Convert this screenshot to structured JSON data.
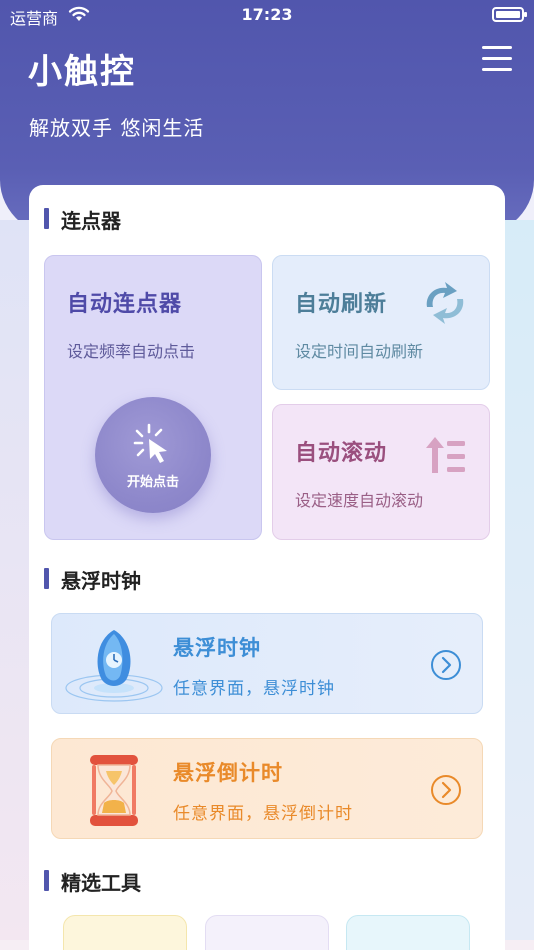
{
  "status": {
    "carrier": "运营商",
    "time": "17:23"
  },
  "header": {
    "title": "小触控",
    "subtitle": "解放双手 悠闲生活"
  },
  "sections": {
    "clicker": "连点器",
    "floating_clock": "悬浮时钟",
    "tools": "精选工具"
  },
  "tiles": {
    "auto_clicker": {
      "title": "自动连点器",
      "desc": "设定频率自动点击",
      "button": "开始点击"
    },
    "auto_refresh": {
      "title": "自动刷新",
      "desc": "设定时间自动刷新"
    },
    "auto_scroll": {
      "title": "自动滚动",
      "desc": "设定速度自动滚动"
    }
  },
  "features": {
    "clock": {
      "title": "悬浮时钟",
      "desc": "任意界面，悬浮时钟"
    },
    "countdown": {
      "title": "悬浮倒计时",
      "desc": "任意界面，悬浮倒计时"
    }
  },
  "colors": {
    "brand": "#5156ad",
    "clicker_text": "#4f4aa8",
    "refresh_text": "#4d7e99",
    "scroll_text": "#9a4f7e",
    "clock_text": "#3d8ed6",
    "timer_text": "#e98a2a"
  },
  "icons": {
    "status": [
      "wifi-icon",
      "battery-icon"
    ],
    "header": "menu-icon",
    "tiles": [
      "cursor-click-icon",
      "refresh-icon",
      "scroll-up-icon"
    ],
    "features": [
      "crystal-clock-icon",
      "hourglass-icon",
      "chevron-right-circle-icon"
    ]
  }
}
